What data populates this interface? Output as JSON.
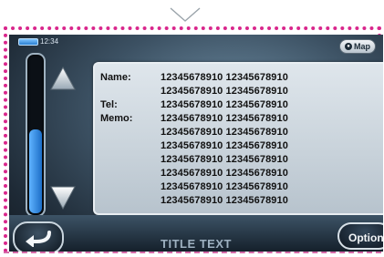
{
  "status": {
    "time": "12:34",
    "map_label": "Map"
  },
  "slider": {
    "level": 0.55
  },
  "panel": {
    "rows": [
      {
        "label": "Name:",
        "value": "12345678910 12345678910"
      },
      {
        "label": "",
        "value": "12345678910 12345678910"
      },
      {
        "label": "Tel:",
        "value": "12345678910 12345678910"
      },
      {
        "label": "Memo:",
        "value": "12345678910 12345678910"
      },
      {
        "label": "",
        "value": "12345678910 12345678910"
      },
      {
        "label": "",
        "value": "12345678910 12345678910"
      },
      {
        "label": "",
        "value": "12345678910 12345678910"
      },
      {
        "label": "",
        "value": "12345678910 12345678910"
      },
      {
        "label": "",
        "value": "12345678910 12345678910"
      },
      {
        "label": "",
        "value": "12345678910 12345678910"
      }
    ]
  },
  "bottom": {
    "title": "TITLE TEXT",
    "option_label": "Option"
  },
  "colors": {
    "frame": "#d9278c",
    "accent": "#2a7fd1"
  }
}
